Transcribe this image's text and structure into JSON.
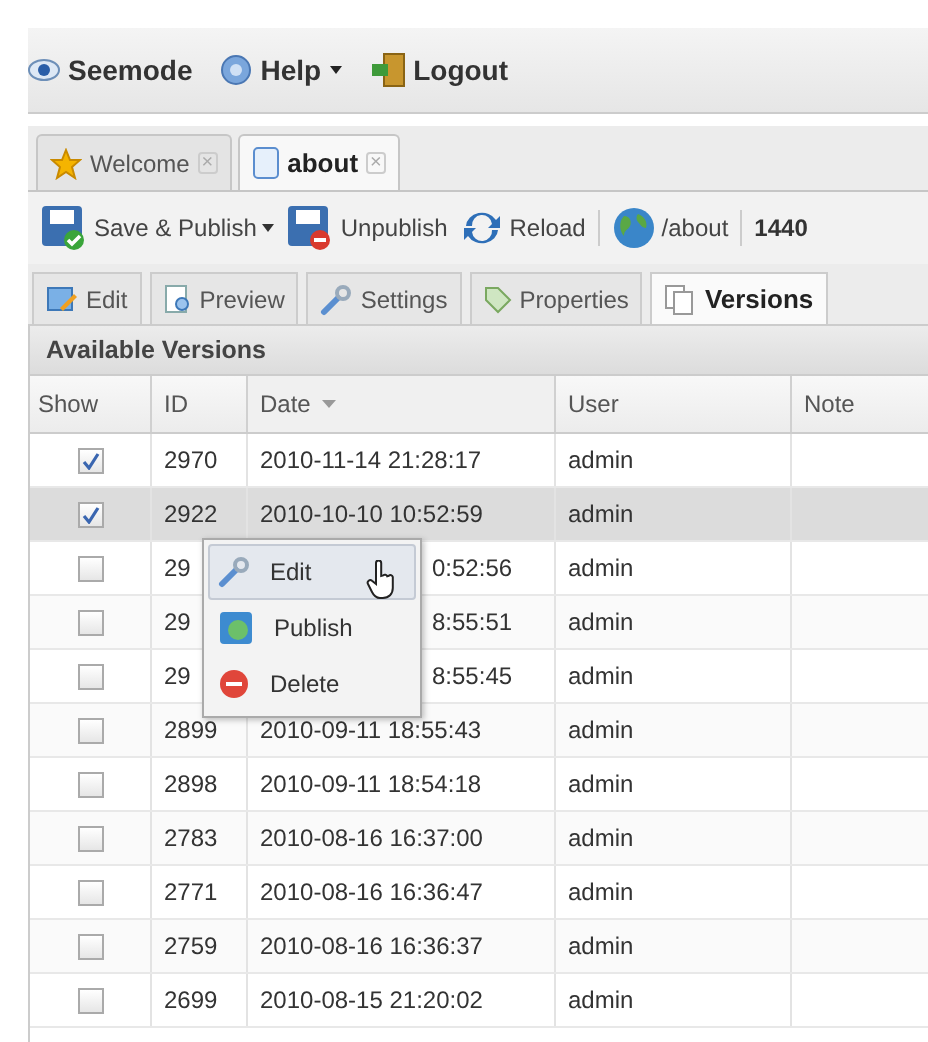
{
  "menu_bar": [
    {
      "kind": "eye",
      "label": "Seemode",
      "dropdown": false
    },
    {
      "kind": "help",
      "label": "Help",
      "dropdown": true
    },
    {
      "kind": "exit",
      "label": "Logout",
      "dropdown": false
    }
  ],
  "tabs": [
    {
      "kind": "star",
      "label": "Welcome",
      "close": "×",
      "selected": false
    },
    {
      "kind": "page",
      "label": "about",
      "close": "×",
      "selected": true
    }
  ],
  "toolbar": [
    {
      "kind": "save",
      "label": "Save & Publish",
      "dropdown": true
    },
    {
      "kind": "unpublish",
      "label": "Unpublish",
      "dropdown": false
    },
    {
      "kind": "reload",
      "label": "Reload",
      "dropdown": false
    },
    {
      "kind": "sep"
    },
    {
      "kind": "globe",
      "label": "/about",
      "dropdown": false
    },
    {
      "kind": "sep"
    },
    {
      "kind": "text",
      "label": "1440"
    }
  ],
  "view_tabs": [
    {
      "kind": "edit",
      "label": "Edit",
      "selected": false
    },
    {
      "kind": "preview",
      "label": "Preview",
      "selected": false
    },
    {
      "kind": "wrench",
      "label": "Settings",
      "selected": false
    },
    {
      "kind": "tag",
      "label": "Properties",
      "selected": false
    },
    {
      "kind": "copies",
      "label": "Versions",
      "selected": true
    }
  ],
  "panel": {
    "title": "Available Versions",
    "columns": [
      {
        "label": "Show",
        "sorted": false
      },
      {
        "label": "ID",
        "sorted": false
      },
      {
        "label": "Date",
        "sorted": true
      },
      {
        "label": "User",
        "sorted": false
      },
      {
        "label": "Note",
        "sorted": false
      }
    ],
    "rows": [
      {
        "show": true,
        "id": "2970",
        "date": "2010-11-14 21:28:17",
        "user": "admin",
        "selected": false,
        "covered": false
      },
      {
        "show": true,
        "id": "2922",
        "date": "2010-10-10 10:52:59",
        "user": "admin",
        "selected": true,
        "covered": false
      },
      {
        "show": false,
        "id": "29",
        "date": "0:52:56",
        "user": "admin",
        "selected": false,
        "covered": true
      },
      {
        "show": false,
        "id": "29",
        "date": "8:55:51",
        "user": "admin",
        "selected": false,
        "covered": true
      },
      {
        "show": false,
        "id": "29",
        "date": "8:55:45",
        "user": "admin",
        "selected": false,
        "covered": true
      },
      {
        "show": false,
        "id": "2899",
        "date": "2010-09-11 18:55:43",
        "user": "admin",
        "selected": false,
        "covered": false
      },
      {
        "show": false,
        "id": "2898",
        "date": "2010-09-11 18:54:18",
        "user": "admin",
        "selected": false,
        "covered": false
      },
      {
        "show": false,
        "id": "2783",
        "date": "2010-08-16 16:37:00",
        "user": "admin",
        "selected": false,
        "covered": false
      },
      {
        "show": false,
        "id": "2771",
        "date": "2010-08-16 16:36:47",
        "user": "admin",
        "selected": false,
        "covered": false
      },
      {
        "show": false,
        "id": "2759",
        "date": "2010-08-16 16:36:37",
        "user": "admin",
        "selected": false,
        "covered": false
      },
      {
        "show": false,
        "id": "2699",
        "date": "2010-08-15 21:20:02",
        "user": "admin",
        "selected": false,
        "covered": false
      }
    ]
  },
  "context_menu": [
    {
      "kind": "wrench",
      "label": "Edit",
      "selected": true
    },
    {
      "kind": "publish",
      "label": "Publish",
      "selected": false
    },
    {
      "kind": "delete",
      "label": "Delete",
      "selected": false
    }
  ]
}
